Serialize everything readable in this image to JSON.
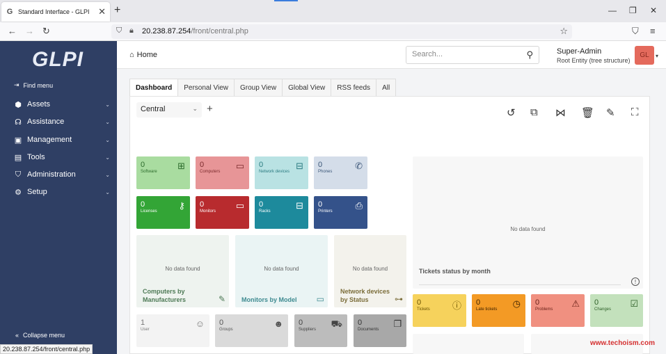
{
  "browser": {
    "tab_title": "Standard Interface - GLPI",
    "url_host": "20.238.87.254",
    "url_path": "/front/central.php",
    "status_url": "20.238.87.254/front/central.php"
  },
  "sidebar": {
    "logo": "GLPI",
    "find_menu": "Find menu",
    "items": [
      {
        "label": "Assets",
        "icon": "cube-icon"
      },
      {
        "label": "Assistance",
        "icon": "headset-icon"
      },
      {
        "label": "Management",
        "icon": "wallet-icon"
      },
      {
        "label": "Tools",
        "icon": "briefcase-icon"
      },
      {
        "label": "Administration",
        "icon": "shield-icon"
      },
      {
        "label": "Setup",
        "icon": "gear-icon"
      }
    ],
    "collapse": "Collapse menu"
  },
  "header": {
    "home": "Home",
    "search_placeholder": "Search...",
    "user_name": "Super-Admin",
    "entity": "Root Entity (tree structure)",
    "avatar_initials": "GL"
  },
  "tabs": [
    "Dashboard",
    "Personal View",
    "Group View",
    "Global View",
    "RSS feeds",
    "All"
  ],
  "dashboard": {
    "selected": "Central",
    "cards_row1": [
      {
        "value": "0",
        "label": "Software",
        "icon": "apps-icon",
        "bg": "#a9dca0",
        "fg": "#2c6b2c"
      },
      {
        "value": "0",
        "label": "Computers",
        "icon": "laptop-icon",
        "bg": "#e79597",
        "fg": "#7a2a2c"
      },
      {
        "value": "0",
        "label": "Network devices",
        "icon": "network-icon",
        "bg": "#b9e2e3",
        "fg": "#2a7b80"
      },
      {
        "value": "0",
        "label": "Phones",
        "icon": "phone-icon",
        "bg": "#d4dde9",
        "fg": "#3a5577"
      }
    ],
    "cards_row2": [
      {
        "value": "0",
        "label": "Licenses",
        "icon": "key-icon",
        "bg": "#33a536",
        "fg": "#ffffff"
      },
      {
        "value": "0",
        "label": "Monitors",
        "icon": "monitor-icon",
        "bg": "#b82b2e",
        "fg": "#ffffff"
      },
      {
        "value": "0",
        "label": "Racks",
        "icon": "server-icon",
        "bg": "#1d8a9c",
        "fg": "#ffffff"
      },
      {
        "value": "0",
        "label": "Printers",
        "icon": "printer-icon",
        "bg": "#34528a",
        "fg": "#ffffff"
      }
    ],
    "no_data": "No data found",
    "big_boxes": [
      {
        "title": "Computers by Manufacturers",
        "icon": "edit-icon",
        "bg": "#eef3ef",
        "fg": "#4e7a56"
      },
      {
        "title": "Monitors by Model",
        "icon": "monitor-icon",
        "bg": "#eaf4f4",
        "fg": "#3e8a90"
      },
      {
        "title": "Network devices by Status",
        "icon": "sitemap-icon",
        "bg": "#f3f2ec",
        "fg": "#7b6d3a"
      }
    ],
    "tickets_chart": {
      "title": "Tickets status by month"
    },
    "status_cards": [
      {
        "value": "0",
        "label": "Tickets",
        "icon": "alert-circle-icon",
        "bg": "#f6d25c",
        "fg": "#6a5200"
      },
      {
        "value": "0",
        "label": "Late tickets",
        "icon": "clock-icon",
        "bg": "#f39a25",
        "fg": "#3d2200"
      },
      {
        "value": "0",
        "label": "Problems",
        "icon": "warning-icon",
        "bg": "#f09080",
        "fg": "#6a2218"
      },
      {
        "value": "0",
        "label": "Changes",
        "icon": "clipboard-check-icon",
        "bg": "#c3e1bc",
        "fg": "#2d5f27"
      }
    ],
    "bottom_cards": [
      {
        "value": "1",
        "label": "User",
        "icon": "user-icon",
        "bg": "#f3f3f3",
        "fg": "#777777"
      },
      {
        "value": "0",
        "label": "Groups",
        "icon": "users-icon",
        "bg": "#dadada",
        "fg": "#555555"
      },
      {
        "value": "0",
        "label": "Suppliers",
        "icon": "dolly-icon",
        "bg": "#bcbcbc",
        "fg": "#444444"
      },
      {
        "value": "0",
        "label": "Documents",
        "icon": "files-icon",
        "bg": "#a8a8a8",
        "fg": "#333333"
      }
    ]
  },
  "watermark": "www.techoism.com"
}
